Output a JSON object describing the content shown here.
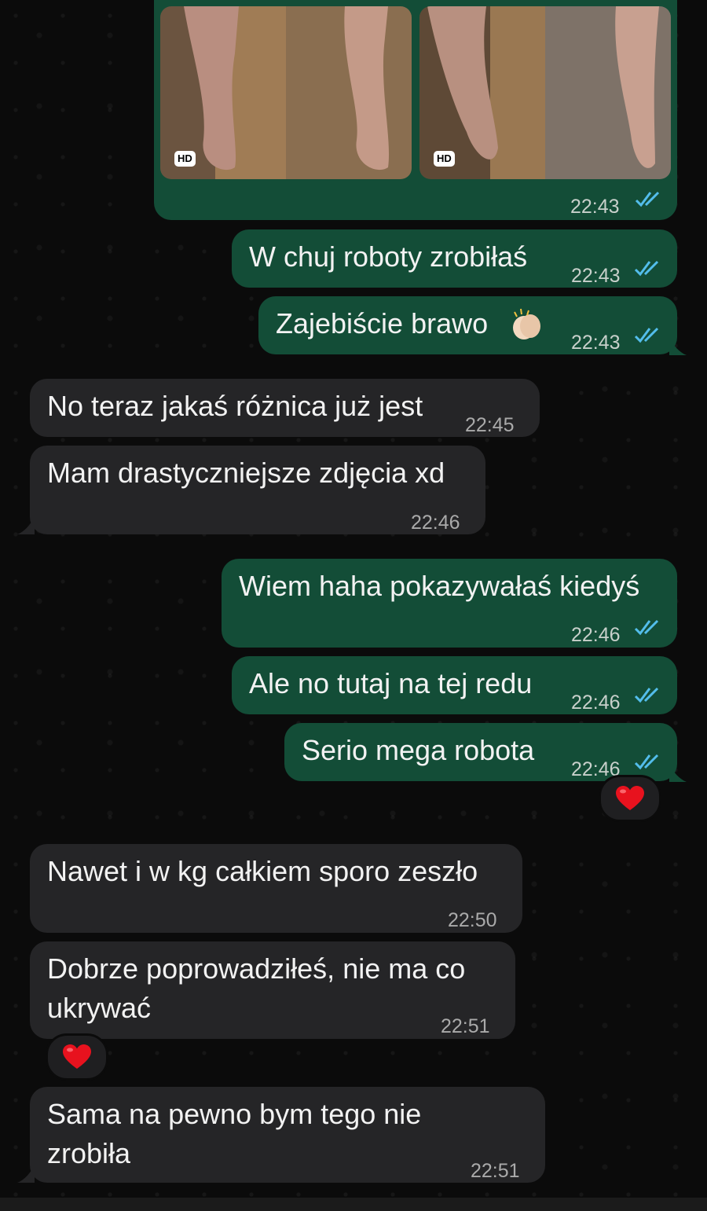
{
  "messages": [
    {
      "id": "m0",
      "dir": "out",
      "kind": "media",
      "time": "22:43",
      "media": [
        {
          "badge": "HD"
        },
        {
          "badge": "HD"
        }
      ]
    },
    {
      "id": "m1",
      "dir": "out",
      "text": "W chuj roboty zrobiłaś",
      "time": "22:43"
    },
    {
      "id": "m2",
      "dir": "out",
      "text": "Zajebiście brawo",
      "emoji": "clapping-hands",
      "time": "22:43"
    },
    {
      "id": "m3",
      "dir": "in",
      "text": "No teraz jakaś różnica już jest",
      "time": "22:45"
    },
    {
      "id": "m4",
      "dir": "in",
      "text": "Mam drastyczniejsze zdjęcia xd",
      "time": "22:46"
    },
    {
      "id": "m5",
      "dir": "out",
      "text": "Wiem haha pokazywałaś kiedyś",
      "time": "22:46"
    },
    {
      "id": "m6",
      "dir": "out",
      "text": "Ale no tutaj na tej redu",
      "time": "22:46"
    },
    {
      "id": "m7",
      "dir": "out",
      "text": "Serio mega robota",
      "time": "22:46",
      "reaction": "red-heart"
    },
    {
      "id": "m8",
      "dir": "in",
      "text": "Nawet i w kg całkiem sporo zeszło",
      "time": "22:50"
    },
    {
      "id": "m9",
      "dir": "in",
      "lines": [
        "Dobrze poprowadziłeś, nie ma co",
        "ukrywać"
      ],
      "time": "22:51",
      "reaction": "red-heart"
    },
    {
      "id": "m10",
      "dir": "in",
      "lines": [
        "Sama na pewno bym tego nie",
        "zrobiła"
      ],
      "time": "22:51"
    }
  ],
  "colors": {
    "outgoing": "#134d37",
    "incoming": "#252527",
    "read_ticks": "#53bdeb",
    "background": "#0b0b0b"
  }
}
